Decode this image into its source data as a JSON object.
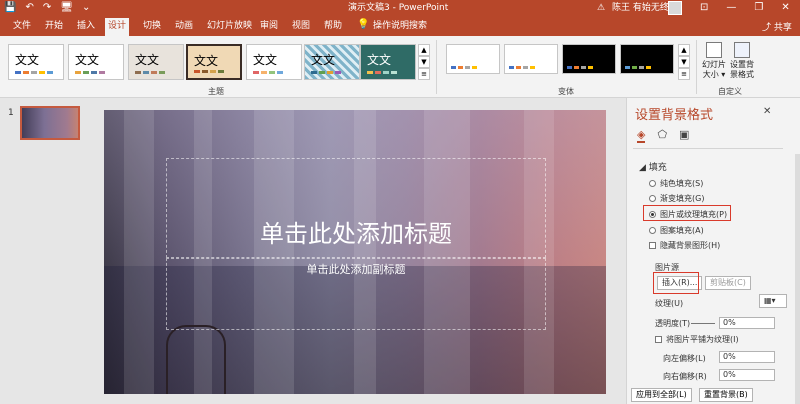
{
  "titlebar": {
    "quick_access": [
      "💾",
      "↶",
      "↷",
      "🖥",
      "⌄"
    ],
    "document_title": "演示文稿3 - PowerPoint",
    "warning_icon": "warning-icon",
    "user_name": "陈王 有始无终",
    "window_controls": [
      "⊡",
      "—",
      "❐",
      "✕"
    ]
  },
  "tabs": {
    "items": [
      {
        "label": "文件"
      },
      {
        "label": "开始"
      },
      {
        "label": "插入"
      },
      {
        "label": "设计"
      },
      {
        "label": "切换"
      },
      {
        "label": "动画"
      },
      {
        "label": "幻灯片放映"
      },
      {
        "label": "审阅"
      },
      {
        "label": "视图"
      },
      {
        "label": "帮助"
      }
    ],
    "active": "设计",
    "tell_me": "操作说明搜索",
    "share": "共享"
  },
  "ribbon": {
    "themes_label": "主题",
    "theme_sample_text": "文文",
    "variants_label": "变体",
    "customize_label": "自定义",
    "slide_size": {
      "line1": "幻灯片",
      "line2": "大小 ▾"
    },
    "format_background": {
      "line1": "设置背",
      "line2": "景格式"
    }
  },
  "slides": {
    "number": "1"
  },
  "slide": {
    "title": "单击此处添加标题",
    "subtitle": "单击此处添加副标题"
  },
  "format_panel": {
    "title": "设置背景格式",
    "close": "✕",
    "section_fill": "◢ 填充",
    "options": {
      "solid": "纯色填充(S)",
      "gradient": "渐变填充(G)",
      "picture": "图片或纹理填充(P)",
      "pattern": "图案填充(A)",
      "hide_graphics": "隐藏背景图形(H)"
    },
    "picture_source": "图片源",
    "insert_button": "插入(R)...",
    "clipboard_button": "剪贴板(C)",
    "texture": "纹理(U)",
    "transparency": "透明度(T)",
    "transparency_value": "0%",
    "tile": "将图片平铺为纹理(I)",
    "offset_left": "向左偏移(L)",
    "offset_left_value": "0%",
    "offset_right": "向右偏移(R)",
    "offset_right_value": "0%",
    "apply_all": "应用到全部(L)",
    "reset": "重置背景(B)"
  }
}
